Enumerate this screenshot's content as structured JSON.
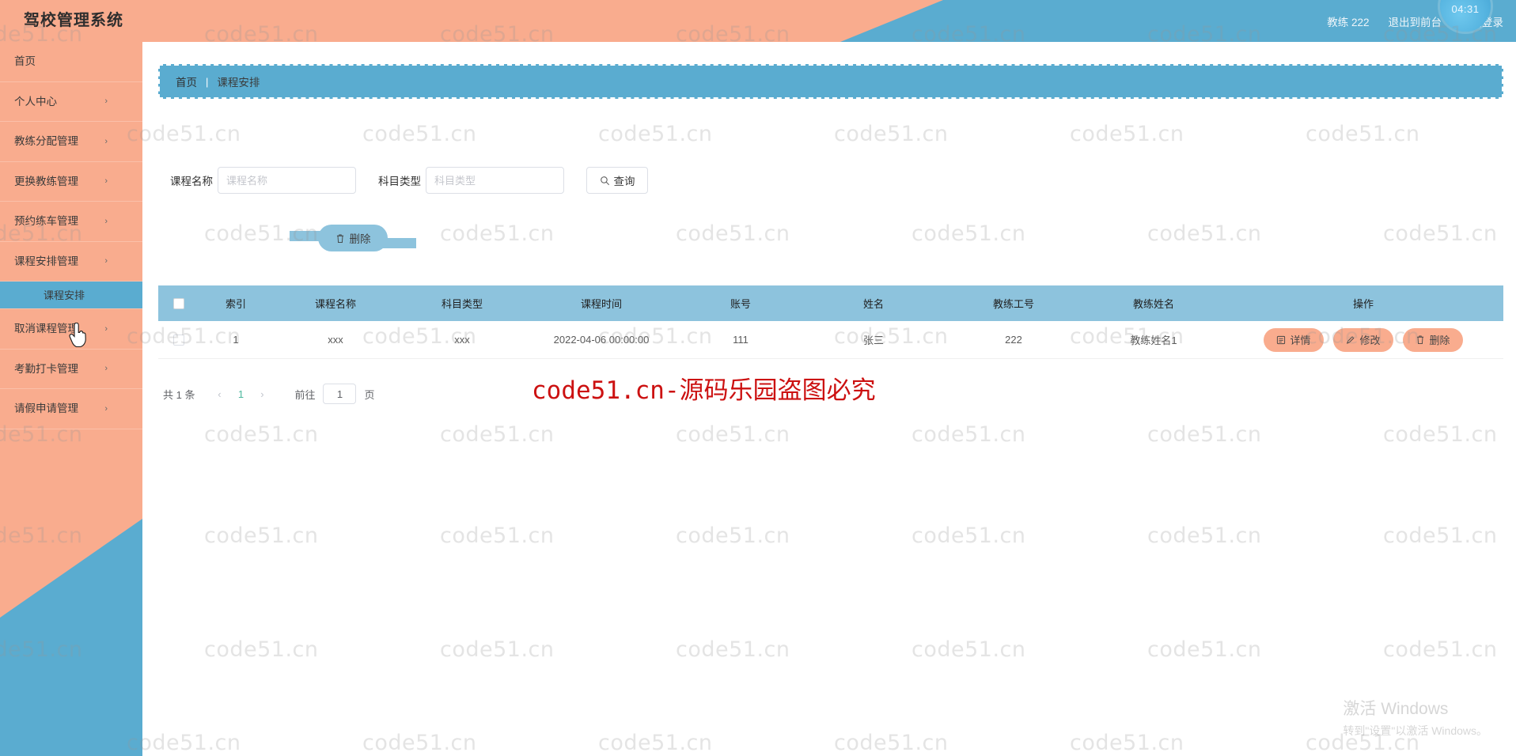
{
  "header": {
    "title": "驾校管理系统",
    "user_label": "教练 222",
    "exit_front_label": "退出到前台",
    "logout_label": "退出登录",
    "clock_time": "04:31",
    "salmon_color": "#f9ac8e",
    "blue_color": "#5aacd0"
  },
  "sidebar": {
    "items": [
      {
        "label": "首页",
        "has_chevron": false
      },
      {
        "label": "个人中心",
        "has_chevron": true
      },
      {
        "label": "教练分配管理",
        "has_chevron": true
      },
      {
        "label": "更换教练管理",
        "has_chevron": true
      },
      {
        "label": "预约练车管理",
        "has_chevron": true
      },
      {
        "label": "课程安排管理",
        "has_chevron": true
      },
      {
        "label": "取消课程管理",
        "has_chevron": true
      },
      {
        "label": "考勤打卡管理",
        "has_chevron": true
      },
      {
        "label": "请假申请管理",
        "has_chevron": true
      }
    ],
    "active_submenu": "课程安排",
    "chevron_glyph": "›"
  },
  "breadcrumb": {
    "home": "首页",
    "separator": "|",
    "current": "课程安排"
  },
  "filters": {
    "course_name_label": "课程名称",
    "course_name_placeholder": "课程名称",
    "course_name_value": "",
    "subject_type_label": "科目类型",
    "subject_type_placeholder": "科目类型",
    "subject_type_value": "",
    "search_button": "查询",
    "search_icon": "search-icon"
  },
  "toolbar": {
    "delete_label": "删除",
    "delete_icon": "trash-icon"
  },
  "table": {
    "headers": [
      "索引",
      "课程名称",
      "科目类型",
      "课程时间",
      "账号",
      "姓名",
      "教练工号",
      "教练姓名",
      "操作"
    ],
    "rows": [
      {
        "index": "1",
        "course_name": "xxx",
        "subject_type": "xxx",
        "course_time": "2022-04-06 00:00:00",
        "account": "111",
        "name": "张三",
        "coach_no": "222",
        "coach_name": "教练姓名1",
        "ops": [
          {
            "label": "详情",
            "icon": "document-icon"
          },
          {
            "label": "修改",
            "icon": "pencil-icon"
          },
          {
            "label": "删除",
            "icon": "trash-icon"
          }
        ]
      }
    ]
  },
  "pagination": {
    "total_text": "共 1 条",
    "prev_glyph": "‹",
    "next_glyph": "›",
    "current_page": "1",
    "goto_label": "前往",
    "goto_value": "1",
    "page_unit": "页"
  },
  "watermarks": {
    "tile_text": "code51.cn",
    "red_text": "code51.cn-源码乐园盗图必究",
    "windows_line1": "激活 Windows",
    "windows_line2": "转到\"设置\"以激活 Windows。"
  }
}
